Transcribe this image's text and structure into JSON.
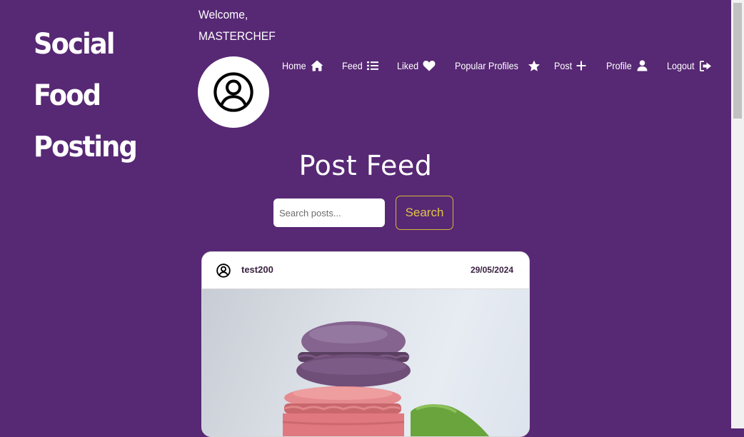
{
  "brand": {
    "line1": "Social Food",
    "line2": "Posting"
  },
  "welcome": {
    "greeting": "Welcome,",
    "username": "MASTERCHEF"
  },
  "nav": {
    "home": "Home",
    "feed": "Feed",
    "liked": "Liked",
    "popular": "Popular Profiles",
    "post": "Post",
    "profile": "Profile",
    "logout": "Logout"
  },
  "page": {
    "title": "Post Feed"
  },
  "search": {
    "placeholder": "Search posts...",
    "value": "",
    "button": "Search"
  },
  "posts": [
    {
      "username": "test200",
      "date": "29/05/2024",
      "image": "macarons-photo"
    }
  ],
  "colors": {
    "background": "#572874",
    "accent": "#e3c447",
    "card": "#ffffff"
  }
}
